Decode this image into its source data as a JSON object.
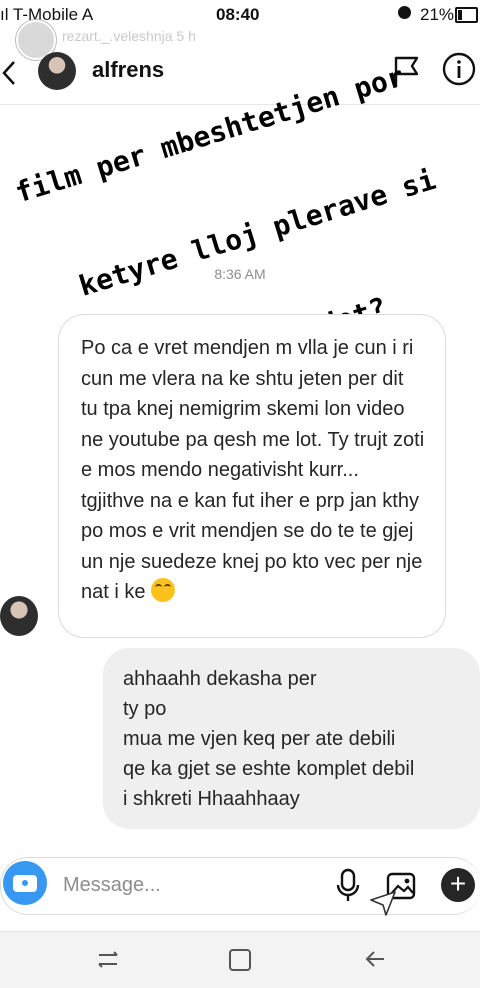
{
  "status_bar": {
    "carrier": "ıl T-Mobile A",
    "time": "08:40",
    "battery_pct": "21%"
  },
  "story_overlay": {
    "username": "rezart._.veleshnja 5 h"
  },
  "header": {
    "title": "alfrens"
  },
  "story_text": {
    "lines": [
      "film per mbeshtetjen por",
      "  ketyre lloj plerave si",
      "     shmangemi dot?"
    ]
  },
  "thread": {
    "timestamp": "8:36 AM",
    "incoming_message": "Po ca e vret mendjen m vlla je cun i ri cun me vlera na ke shtu jeten per dit tu tpa knej nemigrim skemi lon video ne youtube pa qesh me lot. Ty trujt zoti e mos mendo negativisht kurr... tgjithve na e kan fut iher e prp jan kthy po mos e vrit mendjen se do te te gjej un nje suedeze knej po kto vec per nje nat i ke",
    "outgoing_message_lines": [
      "ahhaahh dekasha per",
      "ty po",
      "mua me vjen keq per ate debili",
      "qe ka gjet se eshte komplet debil",
      "i shkreti Hhaahhaay"
    ]
  },
  "composer": {
    "placeholder": "Message..."
  },
  "icons": {
    "back": "chevron-left-icon",
    "flag": "flag-icon",
    "info": "info-icon",
    "camera": "camera-icon",
    "mic": "microphone-icon",
    "gallery": "image-icon",
    "plus": "plus-icon",
    "emoji": "tears-of-joy-emoji"
  },
  "colors": {
    "accent": "#3897f0",
    "outgoing_bubble": "#efefef",
    "incoming_border": "#dbdbdb"
  }
}
